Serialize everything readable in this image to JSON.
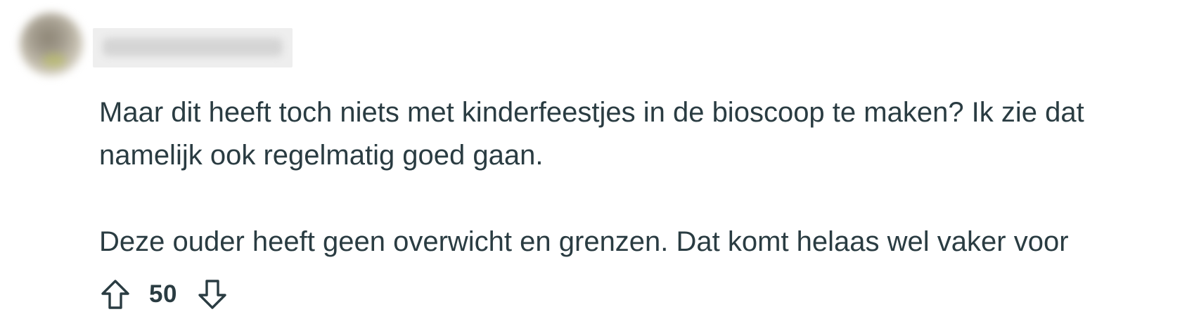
{
  "comment": {
    "author": {
      "username": "redacted-username"
    },
    "paragraphs": [
      "Maar dit heeft toch niets met kinderfeestjes in de bioscoop te maken? Ik zie dat namelijk ook regelmatig goed gaan.",
      "Deze ouder heeft geen overwicht en grenzen. Dat komt helaas wel vaker voor"
    ],
    "votes": {
      "score": "50",
      "upvote_icon": "arrow-up-outline-icon",
      "downvote_icon": "arrow-down-outline-icon"
    }
  },
  "colors": {
    "text": "#2a3c42",
    "background": "#ffffff",
    "username_redaction": "#eeeeee"
  }
}
